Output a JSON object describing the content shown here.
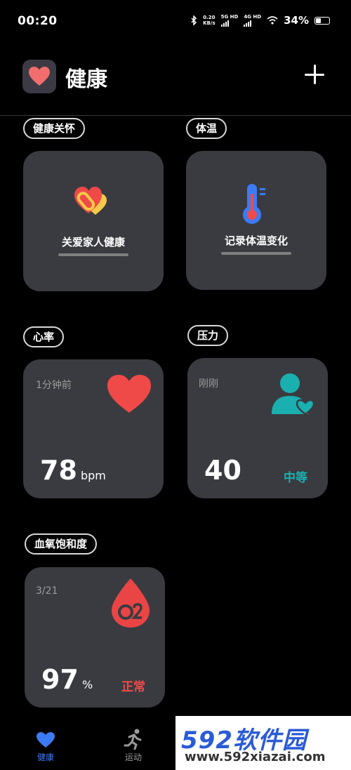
{
  "status_bar": {
    "time": "00:20",
    "net_speed": "0.20",
    "net_unit": "KB/s",
    "sim1": "5G HD",
    "sim2": "4G HD",
    "battery": "34%"
  },
  "header": {
    "title": "健康",
    "add_icon": "plus-icon",
    "logo_icon": "heart-icon"
  },
  "sections": {
    "care": {
      "chip": "健康关怀",
      "card_label": "关爱家人健康"
    },
    "temp": {
      "chip": "体温",
      "card_label": "记录体温变化"
    },
    "heart": {
      "chip": "心率",
      "time": "1分钟前",
      "value": "78",
      "unit": "bpm"
    },
    "stress": {
      "chip": "压力",
      "time": "刚刚",
      "value": "40",
      "level": "中等"
    },
    "spo2": {
      "chip": "血氧饱和度",
      "date": "3/21",
      "value": "97",
      "unit": "%",
      "level": "正常"
    }
  },
  "nav": {
    "items": [
      {
        "label": "健康",
        "icon": "heart-icon"
      },
      {
        "label": "运动",
        "icon": "run-icon"
      }
    ]
  },
  "watermark": {
    "brand": "592软件园",
    "url": "www.592xiazai.com"
  },
  "colors": {
    "accent_red": "#f04a4a",
    "teal": "#1ab0b0",
    "card": "#3a3b40",
    "nav_blue": "#3d7bf5"
  }
}
